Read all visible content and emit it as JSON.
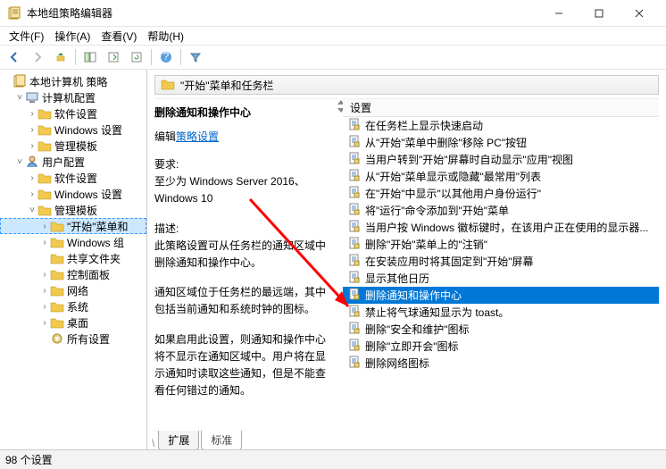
{
  "window": {
    "title": "本地组策略编辑器"
  },
  "menubar": {
    "file": "文件(F)",
    "action": "操作(A)",
    "view": "查看(V)",
    "help": "帮助(H)"
  },
  "tree": {
    "root": "本地计算机 策略",
    "computer_config": "计算机配置",
    "nodes": {
      "software_settings": "软件设置",
      "windows_settings": "Windows 设置",
      "admin_templates": "管理模板"
    },
    "user_config": "用户配置",
    "user_nodes": {
      "software_settings": "软件设置",
      "windows_settings": "Windows 设置",
      "admin_templates": "管理模板",
      "start_taskbar": "\"开始\"菜单和",
      "windows_components": "Windows 组",
      "shared_folders": "共享文件夹",
      "control_panel": "控制面板",
      "network": "网络",
      "system": "系统",
      "desktop": "桌面",
      "all_settings": "所有设置"
    }
  },
  "header": {
    "title": "\"开始\"菜单和任务栏"
  },
  "description": {
    "setting_name": "删除通知和操作中心",
    "edit_label": "编辑",
    "edit_link": "策略设置",
    "req_label": "要求:",
    "req_text": "至少为 Windows Server 2016、Windows 10",
    "desc_label": "描述:",
    "desc_text1": "此策略设置可从任务栏的通知区域中删除通知和操作中心。",
    "desc_text2": "通知区域位于任务栏的最远端，其中包括当前通知和系统时钟的图标。",
    "desc_text3": "如果启用此设置，则通知和操作中心将不显示在通知区域中。用户将在显示通知时读取这些通知，但是不能查看任何错过的通知。"
  },
  "list_header": "设置",
  "settings_list": [
    "在任务栏上显示快速启动",
    "从\"开始\"菜单中删除\"移除 PC\"按钮",
    "当用户转到\"开始\"屏幕时自动显示\"应用\"视图",
    "从\"开始\"菜单显示或隐藏\"最常用\"列表",
    "在\"开始\"中显示\"以其他用户身份运行\"",
    "将\"运行\"命令添加到\"开始\"菜单",
    "当用户按 Windows 徽标键时，在该用户正在使用的显示器...",
    "删除\"开始\"菜单上的\"注销\"",
    "在安装应用时将其固定到\"开始\"屏幕",
    "显示其他日历",
    "删除通知和操作中心",
    "禁止将气球通知显示为 toast。",
    "删除\"安全和维护\"图标",
    "删除\"立即开会\"图标",
    "删除网络图标"
  ],
  "selected_index": 10,
  "tabs": {
    "extended": "扩展",
    "standard": "标准"
  },
  "statusbar": "98 个设置"
}
